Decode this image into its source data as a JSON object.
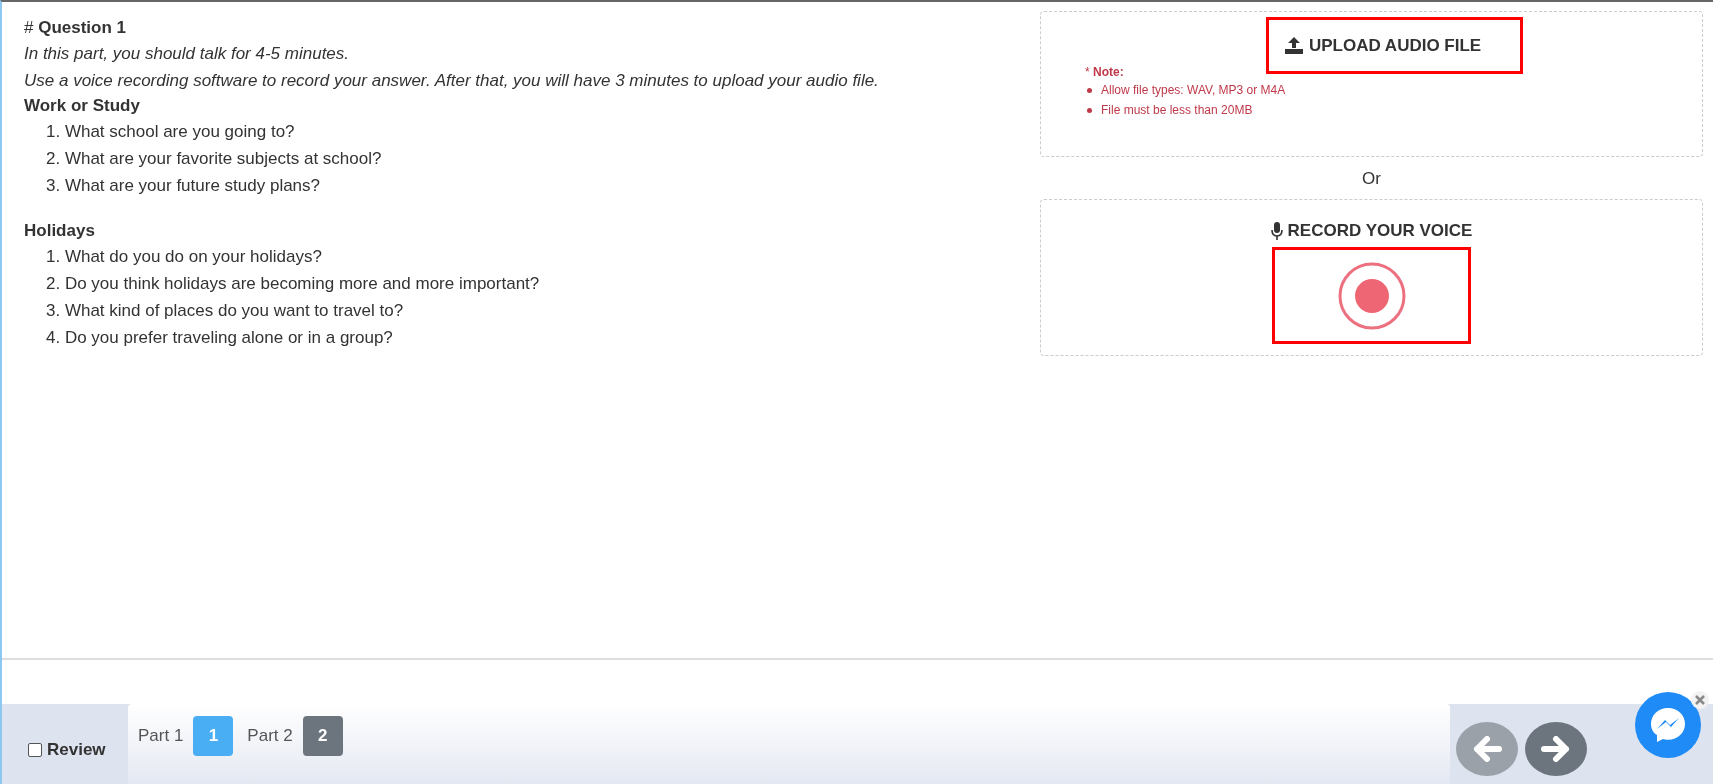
{
  "question": {
    "hash": "#",
    "title": "Question 1",
    "instructions": [
      "In this part, you should talk for 4-5 minutes.",
      "Use a voice recording software to record your answer. After that, you will have 3 minutes to upload your audio file."
    ],
    "topics": [
      {
        "title": "Work or Study",
        "items": [
          "1. What school are you going to?",
          "2. What are your favorite subjects at school?",
          "3. What are your future study plans?"
        ]
      },
      {
        "title": "Holidays",
        "items": [
          "1. What do you do on your holidays?",
          "2. Do you think holidays are becoming more and more important?",
          "3. What kind of places do you want to travel to?",
          "4. Do you prefer traveling alone or in a group?"
        ]
      }
    ]
  },
  "upload": {
    "label": "UPLOAD AUDIO FILE",
    "note_mark": "*",
    "note_title": "Note:",
    "notes": [
      "Allow file types: WAV, MP3 or M4A",
      "File must be less than 20MB"
    ]
  },
  "or": "Or",
  "record": {
    "label": "RECORD YOUR VOICE"
  },
  "footer": {
    "review": {
      "label": "Review",
      "checked": false
    },
    "parts": [
      {
        "label": "Part 1",
        "number": "1",
        "selected": true
      },
      {
        "label": "Part 2",
        "number": "2",
        "selected": false
      }
    ],
    "nav": [
      {
        "kind": "prev",
        "disabled": true
      },
      {
        "kind": "next",
        "disabled": false
      }
    ]
  }
}
